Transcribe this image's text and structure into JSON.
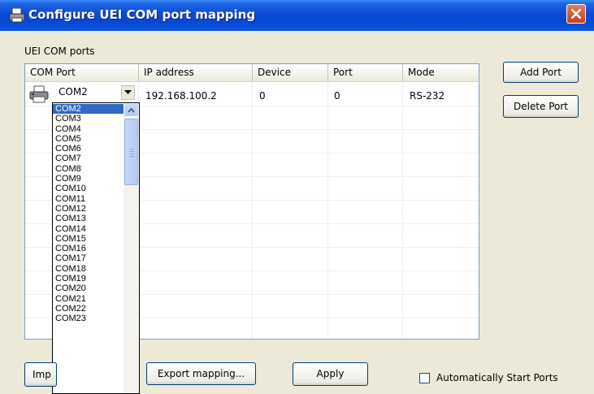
{
  "window": {
    "title": "Configure UEI COM port mapping"
  },
  "group_label": "UEI COM ports",
  "columns": [
    "COM Port",
    "IP address",
    "Device",
    "Port",
    "Mode"
  ],
  "row": {
    "com_port": "COM2",
    "ip": "192.168.100.2",
    "device": "0",
    "port": "0",
    "mode": "RS-232"
  },
  "dropdown_items": [
    "COM2",
    "COM3",
    "COM4",
    "COM5",
    "COM6",
    "COM7",
    "COM8",
    "COM9",
    "COM10",
    "COM11",
    "COM12",
    "COM13",
    "COM14",
    "COM15",
    "COM16",
    "COM17",
    "COM18",
    "COM19",
    "COM20",
    "COM21",
    "COM22",
    "COM23"
  ],
  "dropdown_selected": "COM2",
  "buttons": {
    "add_port": "Add Port",
    "delete_port": "Delete Port",
    "import_partial": "Imp",
    "export": "Export mapping...",
    "apply": "Apply"
  },
  "auto_start_label": "Automatically Start Ports",
  "colors": {
    "title_bar": "#0A4BD6",
    "selection": "#316AC5",
    "face": "#ECE9D8"
  }
}
